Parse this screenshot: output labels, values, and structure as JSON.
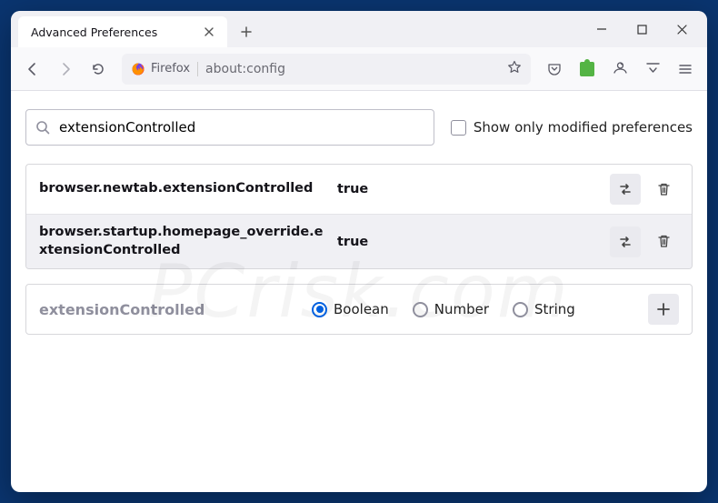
{
  "tab": {
    "title": "Advanced Preferences"
  },
  "urlbar": {
    "identity": "Firefox",
    "url": "about:config"
  },
  "search": {
    "value": "extensionControlled",
    "checkbox_label": "Show only modified preferences"
  },
  "prefs": [
    {
      "name": "browser.newtab.extensionControlled",
      "value": "true"
    },
    {
      "name": "browser.startup.homepage_override.extensionControlled",
      "value": "true"
    }
  ],
  "add_row": {
    "name": "extensionControlled",
    "types": [
      "Boolean",
      "Number",
      "String"
    ],
    "selected": "Boolean"
  },
  "watermark": "PCrisk.com"
}
